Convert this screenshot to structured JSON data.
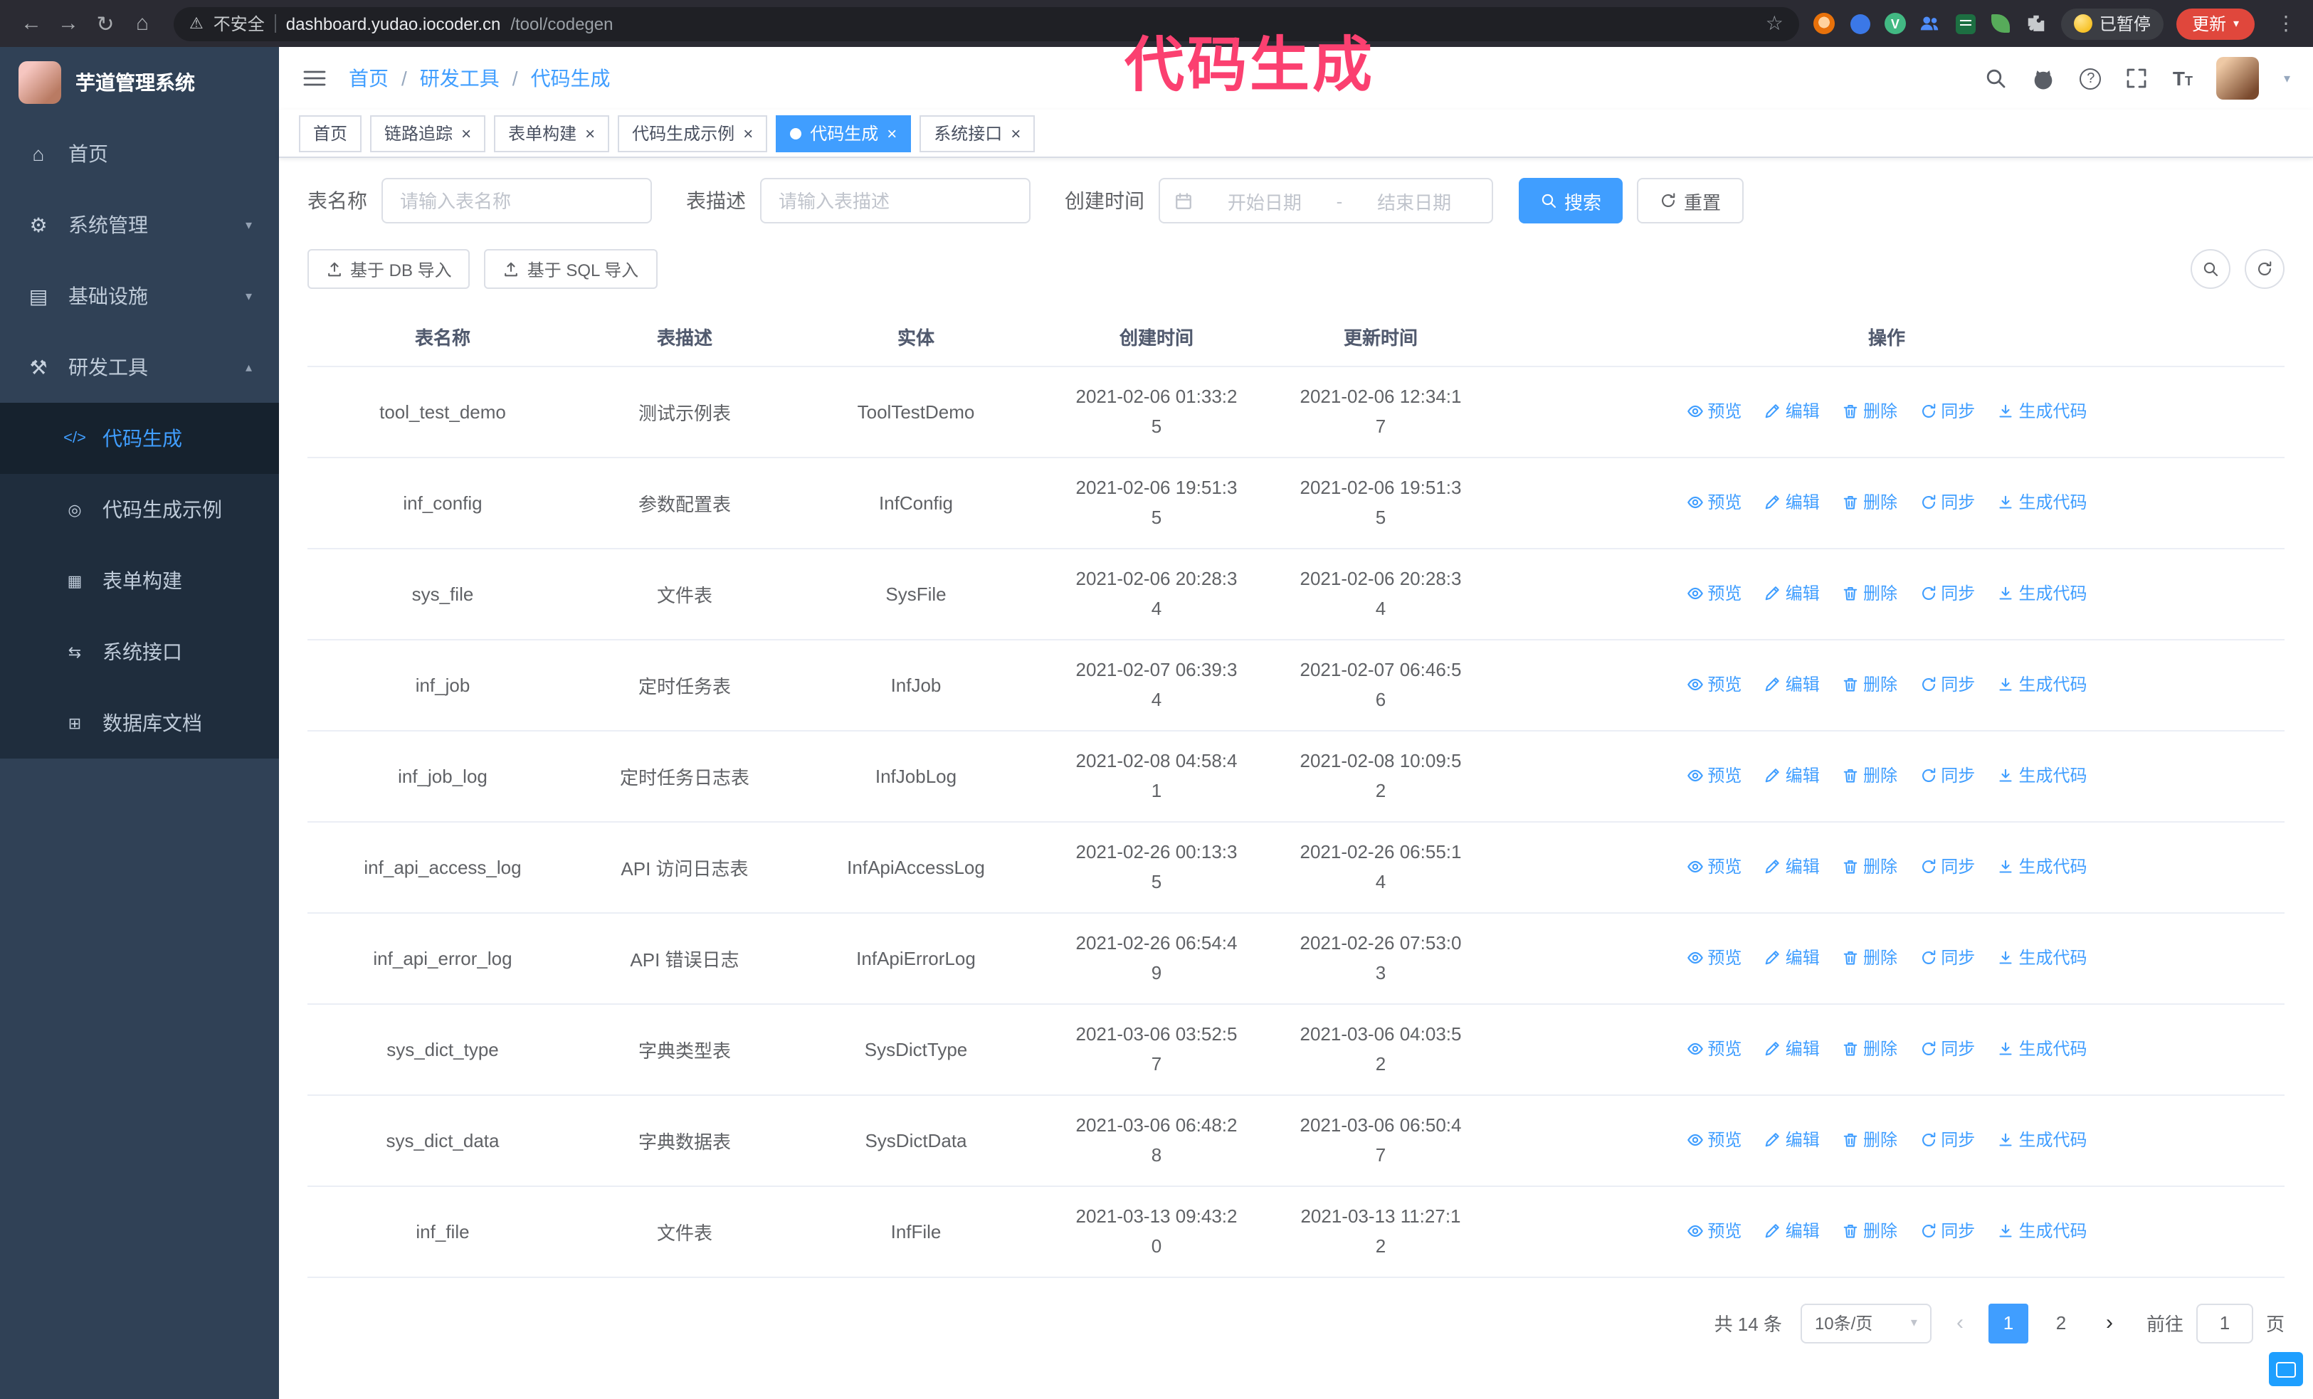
{
  "annotation": {
    "text": "代码生成",
    "color": "#fb4070"
  },
  "browser": {
    "security_label": "不安全",
    "url_host": "dashboard.yudao.iocoder.cn",
    "url_path": "/tool/codegen",
    "paused_label": "已暂停",
    "update_label": "更新"
  },
  "sidebar": {
    "title": "芋道管理系统",
    "items": [
      {
        "label": "首页",
        "icon": "home-icon"
      },
      {
        "label": "系统管理",
        "icon": "gear-icon",
        "chevron": "down"
      },
      {
        "label": "基础设施",
        "icon": "infra-icon",
        "chevron": "down"
      },
      {
        "label": "研发工具",
        "icon": "tools-icon",
        "chevron": "up",
        "expanded": true
      }
    ],
    "submenu": [
      {
        "label": "代码生成",
        "icon": "code-icon",
        "active": true
      },
      {
        "label": "代码生成示例",
        "icon": "example-icon"
      },
      {
        "label": "表单构建",
        "icon": "form-icon"
      },
      {
        "label": "系统接口",
        "icon": "api-icon"
      },
      {
        "label": "数据库文档",
        "icon": "database-icon"
      }
    ]
  },
  "header": {
    "breadcrumb": [
      "首页",
      "研发工具",
      "代码生成"
    ],
    "separator": "/"
  },
  "tabs": [
    {
      "label": "首页",
      "closable": false,
      "active": false
    },
    {
      "label": "链路追踪",
      "closable": true,
      "active": false
    },
    {
      "label": "表单构建",
      "closable": true,
      "active": false
    },
    {
      "label": "代码生成示例",
      "closable": true,
      "active": false
    },
    {
      "label": "代码生成",
      "closable": true,
      "active": true
    },
    {
      "label": "系统接口",
      "closable": true,
      "active": false
    }
  ],
  "filters": {
    "table_name_label": "表名称",
    "table_name_placeholder": "请输入表名称",
    "table_desc_label": "表描述",
    "table_desc_placeholder": "请输入表描述",
    "create_time_label": "创建时间",
    "date_start_placeholder": "开始日期",
    "date_separator": "-",
    "date_end_placeholder": "结束日期",
    "search_button": "搜索",
    "reset_button": "重置"
  },
  "toolbar": {
    "import_db_button": "基于 DB 导入",
    "import_sql_button": "基于 SQL 导入"
  },
  "table": {
    "columns": [
      "表名称",
      "表描述",
      "实体",
      "创建时间",
      "更新时间",
      "操作"
    ],
    "actions": [
      "预览",
      "编辑",
      "删除",
      "同步",
      "生成代码"
    ],
    "rows": [
      {
        "name": "tool_test_demo",
        "desc": "测试示例表",
        "entity": "ToolTestDemo",
        "created": "2021-02-06 01:33:25",
        "updated": "2021-02-06 12:34:17"
      },
      {
        "name": "inf_config",
        "desc": "参数配置表",
        "entity": "InfConfig",
        "created": "2021-02-06 19:51:35",
        "updated": "2021-02-06 19:51:35"
      },
      {
        "name": "sys_file",
        "desc": "文件表",
        "entity": "SysFile",
        "created": "2021-02-06 20:28:34",
        "updated": "2021-02-06 20:28:34"
      },
      {
        "name": "inf_job",
        "desc": "定时任务表",
        "entity": "InfJob",
        "created": "2021-02-07 06:39:34",
        "updated": "2021-02-07 06:46:56"
      },
      {
        "name": "inf_job_log",
        "desc": "定时任务日志表",
        "entity": "InfJobLog",
        "created": "2021-02-08 04:58:41",
        "updated": "2021-02-08 10:09:52"
      },
      {
        "name": "inf_api_access_log",
        "desc": "API 访问日志表",
        "entity": "InfApiAccessLog",
        "created": "2021-02-26 00:13:35",
        "updated": "2021-02-26 06:55:14"
      },
      {
        "name": "inf_api_error_log",
        "desc": "API 错误日志",
        "entity": "InfApiErrorLog",
        "created": "2021-02-26 06:54:49",
        "updated": "2021-02-26 07:53:03"
      },
      {
        "name": "sys_dict_type",
        "desc": "字典类型表",
        "entity": "SysDictType",
        "created": "2021-03-06 03:52:57",
        "updated": "2021-03-06 04:03:52"
      },
      {
        "name": "sys_dict_data",
        "desc": "字典数据表",
        "entity": "SysDictData",
        "created": "2021-03-06 06:48:28",
        "updated": "2021-03-06 06:50:47"
      },
      {
        "name": "inf_file",
        "desc": "文件表",
        "entity": "InfFile",
        "created": "2021-03-13 09:43:20",
        "updated": "2021-03-13 11:27:12"
      }
    ]
  },
  "pagination": {
    "total": "共 14 条",
    "page_size": "10条/页",
    "pages": [
      "1",
      "2"
    ],
    "active_page": "1",
    "goto_label": "前往",
    "goto_value": "1",
    "goto_unit": "页"
  },
  "colors": {
    "accent": "#409eff",
    "sidebar_bg": "#304156",
    "submenu_bg": "#1f2d3d",
    "annotation": "#fb4070",
    "update_button": "#e0473c"
  }
}
